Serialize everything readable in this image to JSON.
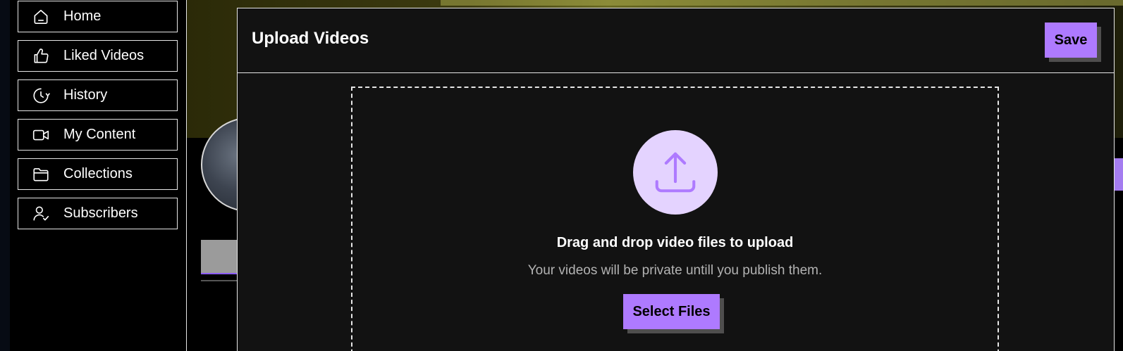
{
  "sidebar": {
    "items": [
      {
        "label": "Home",
        "icon": "home-icon"
      },
      {
        "label": "Liked Videos",
        "icon": "thumbs-up-icon"
      },
      {
        "label": "History",
        "icon": "history-icon"
      },
      {
        "label": "My Content",
        "icon": "video-camera-icon"
      },
      {
        "label": "Collections",
        "icon": "folder-icon"
      },
      {
        "label": "Subscribers",
        "icon": "user-check-icon"
      }
    ]
  },
  "modal": {
    "title": "Upload Videos",
    "save_label": "Save",
    "dropzone": {
      "icon": "upload-icon",
      "heading": "Drag and drop video files to upload",
      "subtext": "Your videos will be private untill you publish them.",
      "select_label": "Select Files"
    }
  },
  "colors": {
    "accent": "#ae7aff",
    "accent_light": "#e4d3ff",
    "modal_bg": "#121212",
    "border": "#e6e6e6"
  }
}
